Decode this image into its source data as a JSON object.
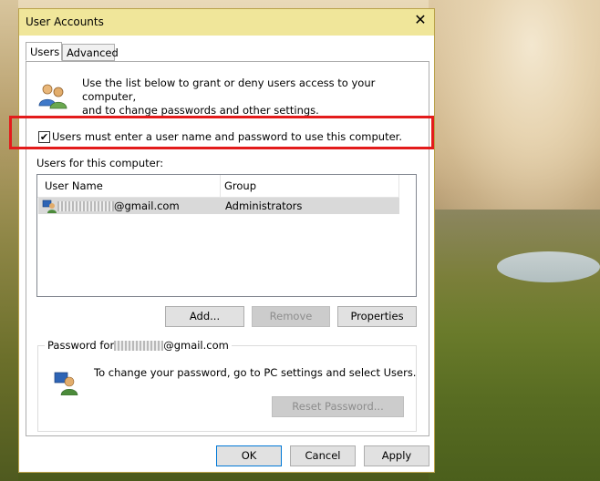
{
  "window": {
    "title": "User Accounts",
    "close_symbol": "✕"
  },
  "tabs": [
    {
      "label": "Users",
      "active": true
    },
    {
      "label": "Advanced",
      "active": false
    }
  ],
  "intro": {
    "line1": "Use the list below to grant or deny users access to your computer,",
    "line2": "and to change passwords and other settings.",
    "icon": "users-icon"
  },
  "require_login": {
    "label": "Users must enter a user name and password to use this computer.",
    "checked": true,
    "check_glyph": "✔"
  },
  "users_list": {
    "label": "Users for this computer:",
    "columns": [
      "User Name",
      "Group"
    ],
    "rows": [
      {
        "user_suffix": "@gmail.com",
        "group": "Administrators",
        "icon": "user-icon",
        "selected": true
      }
    ]
  },
  "list_buttons": {
    "add": "Add...",
    "remove": "Remove",
    "properties": "Properties"
  },
  "password": {
    "title_prefix": "Password for",
    "title_suffix": "@gmail.com",
    "message": "To change your password, go to PC settings and select Users.",
    "reset_button": "Reset Password...",
    "icon": "user-key-icon"
  },
  "footer": {
    "ok": "OK",
    "cancel": "Cancel",
    "apply": "Apply"
  },
  "colors": {
    "titlebar": "#f0e69a",
    "highlight_box": "#e31b1b",
    "default_button_border": "#0078d7"
  }
}
